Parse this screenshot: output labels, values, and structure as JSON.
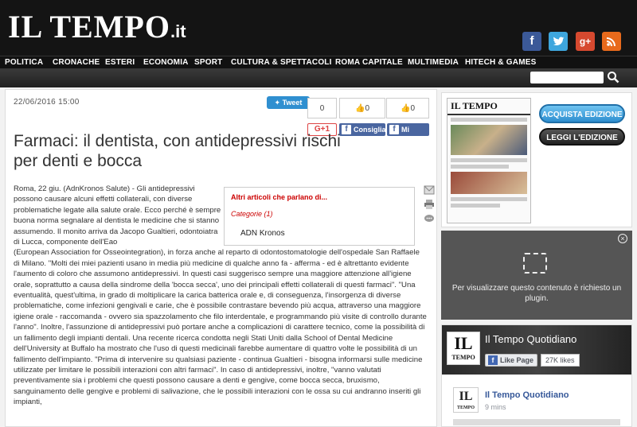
{
  "header": {
    "logo_text": "IL TEMPO",
    "logo_tld": ".it",
    "social": {
      "facebook": "f",
      "twitter": "t",
      "googleplus": "g+",
      "rss": "rss"
    }
  },
  "nav": {
    "items": [
      "POLITICA",
      "CRONACHE",
      "ESTERI",
      "ECONOMIA",
      "SPORT",
      "CULTURA & SPETTACOLI",
      "ROMA CAPITALE",
      "MULTIMEDIA",
      "HITECH & GAMES"
    ]
  },
  "search": {
    "placeholder": "",
    "icon": "search-icon"
  },
  "article": {
    "date": "22/06/2016 15:00",
    "title": "Farmaci: il dentista, con antidepressivi rischi per denti e bocca",
    "share": {
      "tweet_label": "Tweet",
      "count_g": "0",
      "count_like1": "0",
      "count_like2": "0",
      "gplus_label": "G+1",
      "consiglia_label": "Consiglia",
      "mipiace_label": "Mi piace"
    },
    "related": {
      "title": "Altri articoli che parlano di...",
      "category": "Categorie (1)",
      "item": "ADN Kronos"
    },
    "body_p1": "Roma, 22 giu. (AdnKronos Salute) - Gli antidepressivi possono causare alcuni effetti collaterali, con diverse problematiche legate alla salute orale. Ecco perché è sempre buona norma segnalare al dentista le medicine che si stanno assumendo. Il monito arriva da Jacopo Gualtieri, odontoiatra di Lucca, componente dell'Eao",
    "body_p2": "(European Association for Osseointegration), in forza anche al reparto di odontostomatologie dell'ospedale San Raffaele di Milano. \"Molti dei miei pazienti usano in media più medicine di qualche anno fa - afferma - ed è altrettanto evidente l'aumento di coloro che assumono antidepressivi. In questi casi suggerisco sempre una maggiore attenzione all'igiene orale, soprattutto a causa della sindrome della 'bocca secca', uno dei principali effetti collaterali di questi farmaci\". \"Una eventualità, quest'ultima, in grado di moltiplicare la carica batterica orale e, di conseguenza, l'insorgenza di diverse problematiche, come infezioni gengivali e carie, che è possibile contrastare bevendo più acqua, attraverso una maggiore igiene orale - raccomanda - ovvero sia spazzolamento che filo interdentale, e programmando più visite di controllo durante l'anno\". Inoltre, l'assunzione di antidepressivi può portare anche a complicazioni di carattere tecnico, come la possibilità di un fallimento degli impianti dentali. Una recente ricerca condotta negli Stati Uniti dalla School of Dental Medicine dell'University at Buffalo ha mostrato che l'uso di questi medicinali farebbe aumentare di quattro volte le possibilità di un fallimento dell'impianto. \"Prima di intervenire su qualsiasi paziente - continua Gualtieri - bisogna informarsi sulle medicine utilizzate per limitare le possibili interazioni con altri farmaci\". In caso di antidepressivi, inoltre, \"vanno valutati preventivamente sia i problemi che questi possono causare a denti e gengive, come bocca secca, bruxismo, sanguinamento delle gengive e problemi di salivazione, che le possibili interazioni con le ossa su cui andranno inseriti gli impianti,"
  },
  "sidebar": {
    "paper_head": "IL TEMPO",
    "buy_label": "ACQUISTA EDIZIONE",
    "read_label": "LEGGI L'EDIZIONE",
    "plugin_message": "Per visualizzare questo contenuto è richiesto un plugin.",
    "fb": {
      "page_name": "Il Tempo Quotidiano",
      "like_label": "Like Page",
      "likes": "27K likes",
      "post_name": "Il Tempo Quotidiano",
      "post_time": "9 mins",
      "logo_big": "IL",
      "logo_small": "TEMPO"
    }
  },
  "colors": {
    "accent": "#2f8fd0",
    "header_bg": "#141414",
    "link_red": "#cc0000"
  }
}
